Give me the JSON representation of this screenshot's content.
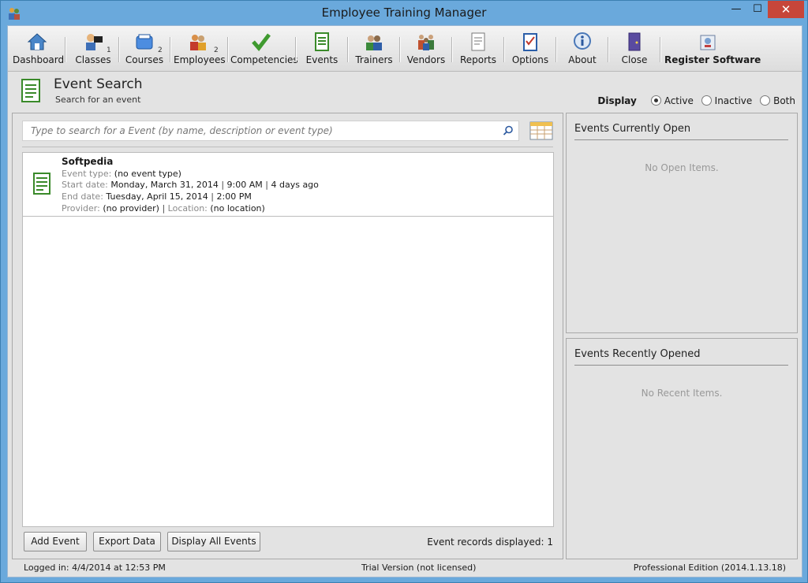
{
  "window": {
    "title": "Employee Training Manager",
    "minimize_glyph": "—",
    "maximize_glyph": "☐",
    "close_glyph": "✕"
  },
  "toolbar": {
    "items": [
      {
        "label": "Dashboard",
        "icon": "house-icon"
      },
      {
        "label": "Classes",
        "badge": "1",
        "icon": "teacher-icon"
      },
      {
        "label": "Courses",
        "badge": "2",
        "icon": "books-icon"
      },
      {
        "label": "Employees",
        "badge": "2",
        "icon": "people-icon"
      },
      {
        "label": "Competencies",
        "icon": "checkmark-icon"
      },
      {
        "label": "Events",
        "icon": "document-icon"
      },
      {
        "label": "Trainers",
        "icon": "trainers-icon"
      },
      {
        "label": "Vendors",
        "icon": "group-icon"
      },
      {
        "label": "Reports",
        "icon": "report-icon"
      },
      {
        "label": "Options",
        "icon": "clipboard-icon"
      },
      {
        "label": "About",
        "icon": "info-icon"
      },
      {
        "label": "Close",
        "icon": "door-icon"
      },
      {
        "label": "Register Software",
        "icon": "register-icon"
      }
    ]
  },
  "header": {
    "title": "Event Search",
    "subtitle": "Search for an event"
  },
  "display": {
    "label": "Display",
    "options": [
      {
        "label": "Active",
        "selected": true
      },
      {
        "label": "Inactive",
        "selected": false
      },
      {
        "label": "Both",
        "selected": false
      }
    ]
  },
  "search": {
    "placeholder": "Type to search for a Event (by name, description or event type)"
  },
  "events": [
    {
      "name": "Softpedia",
      "event_type_label": "Event type:",
      "event_type": "(no event type)",
      "start_label": "Start date:",
      "start_date": "Monday, March 31, 2014",
      "start_time": "9:00 AM",
      "start_ago": "4 days ago",
      "end_label": "End date:",
      "end_date": "Tuesday, April 15, 2014",
      "end_time": "2:00 PM",
      "provider_label": "Provider:",
      "provider": "(no provider)",
      "location_label": "Location:",
      "location": "(no location)"
    }
  ],
  "buttons": {
    "add": "Add Event",
    "export": "Export Data",
    "display_all": "Display All Events"
  },
  "record_count": "Event records displayed: 1",
  "open_panel": {
    "title": "Events Currently Open",
    "empty": "No Open Items."
  },
  "recent_panel": {
    "title": "Events Recently Opened",
    "empty": "No Recent Items."
  },
  "status": {
    "logged_in": "Logged in:  4/4/2014 at 12:53 PM",
    "license": "Trial Version (not licensed)",
    "edition": "Professional Edition (2014.1.13.18)"
  }
}
